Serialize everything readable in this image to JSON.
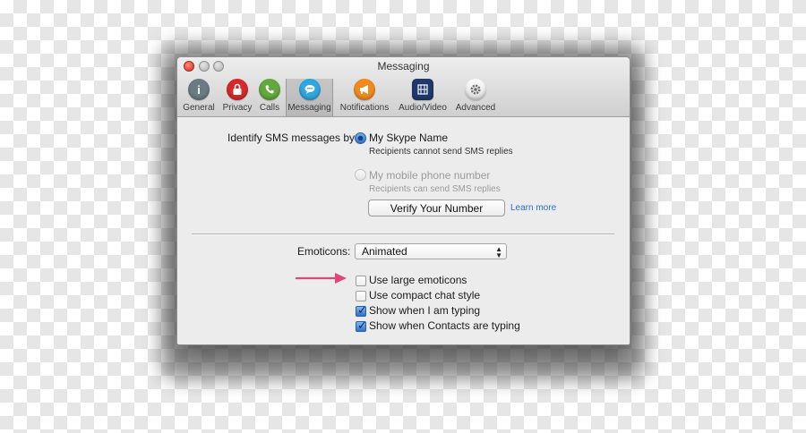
{
  "window": {
    "title": "Messaging"
  },
  "toolbar": {
    "items": [
      {
        "label": "General",
        "icon": "info-icon",
        "glyph": "i",
        "color": "#6b7b83"
      },
      {
        "label": "Privacy",
        "icon": "lock-icon",
        "glyph": "🔒",
        "color": "#d62a2a"
      },
      {
        "label": "Calls",
        "icon": "phone-icon",
        "glyph": "✆",
        "color": "#62a83b"
      },
      {
        "label": "Messaging",
        "icon": "speech-bubble-icon",
        "glyph": "💬",
        "color": "#2ea6e0"
      },
      {
        "label": "Notifications",
        "icon": "megaphone-icon",
        "glyph": "📢",
        "color": "#f08a1e"
      },
      {
        "label": "Audio/Video",
        "icon": "film-icon",
        "glyph": "▦",
        "color": "#1f3a6a"
      },
      {
        "label": "Advanced",
        "icon": "gear-icon",
        "glyph": "⚙",
        "color": "#ffffff"
      }
    ],
    "selected": "Messaging"
  },
  "sms": {
    "label": "Identify SMS messages by:",
    "option1": {
      "label": "My Skype Name",
      "description": "Recipients cannot send SMS replies",
      "selected": true
    },
    "option2": {
      "label": "My mobile phone number",
      "description": "Recipients can send SMS replies",
      "selected": false,
      "disabled": true
    },
    "verify_button": "Verify Your Number",
    "learn_more": "Learn more"
  },
  "emoticons": {
    "label": "Emoticons:",
    "value": "Animated"
  },
  "checkboxes": [
    {
      "label": "Use large emoticons",
      "checked": false
    },
    {
      "label": "Use compact chat style",
      "checked": false
    },
    {
      "label": "Show when I am typing",
      "checked": true
    },
    {
      "label": "Show when Contacts are typing",
      "checked": true
    }
  ],
  "annotation": {
    "arrow_color": "#e0457b"
  }
}
